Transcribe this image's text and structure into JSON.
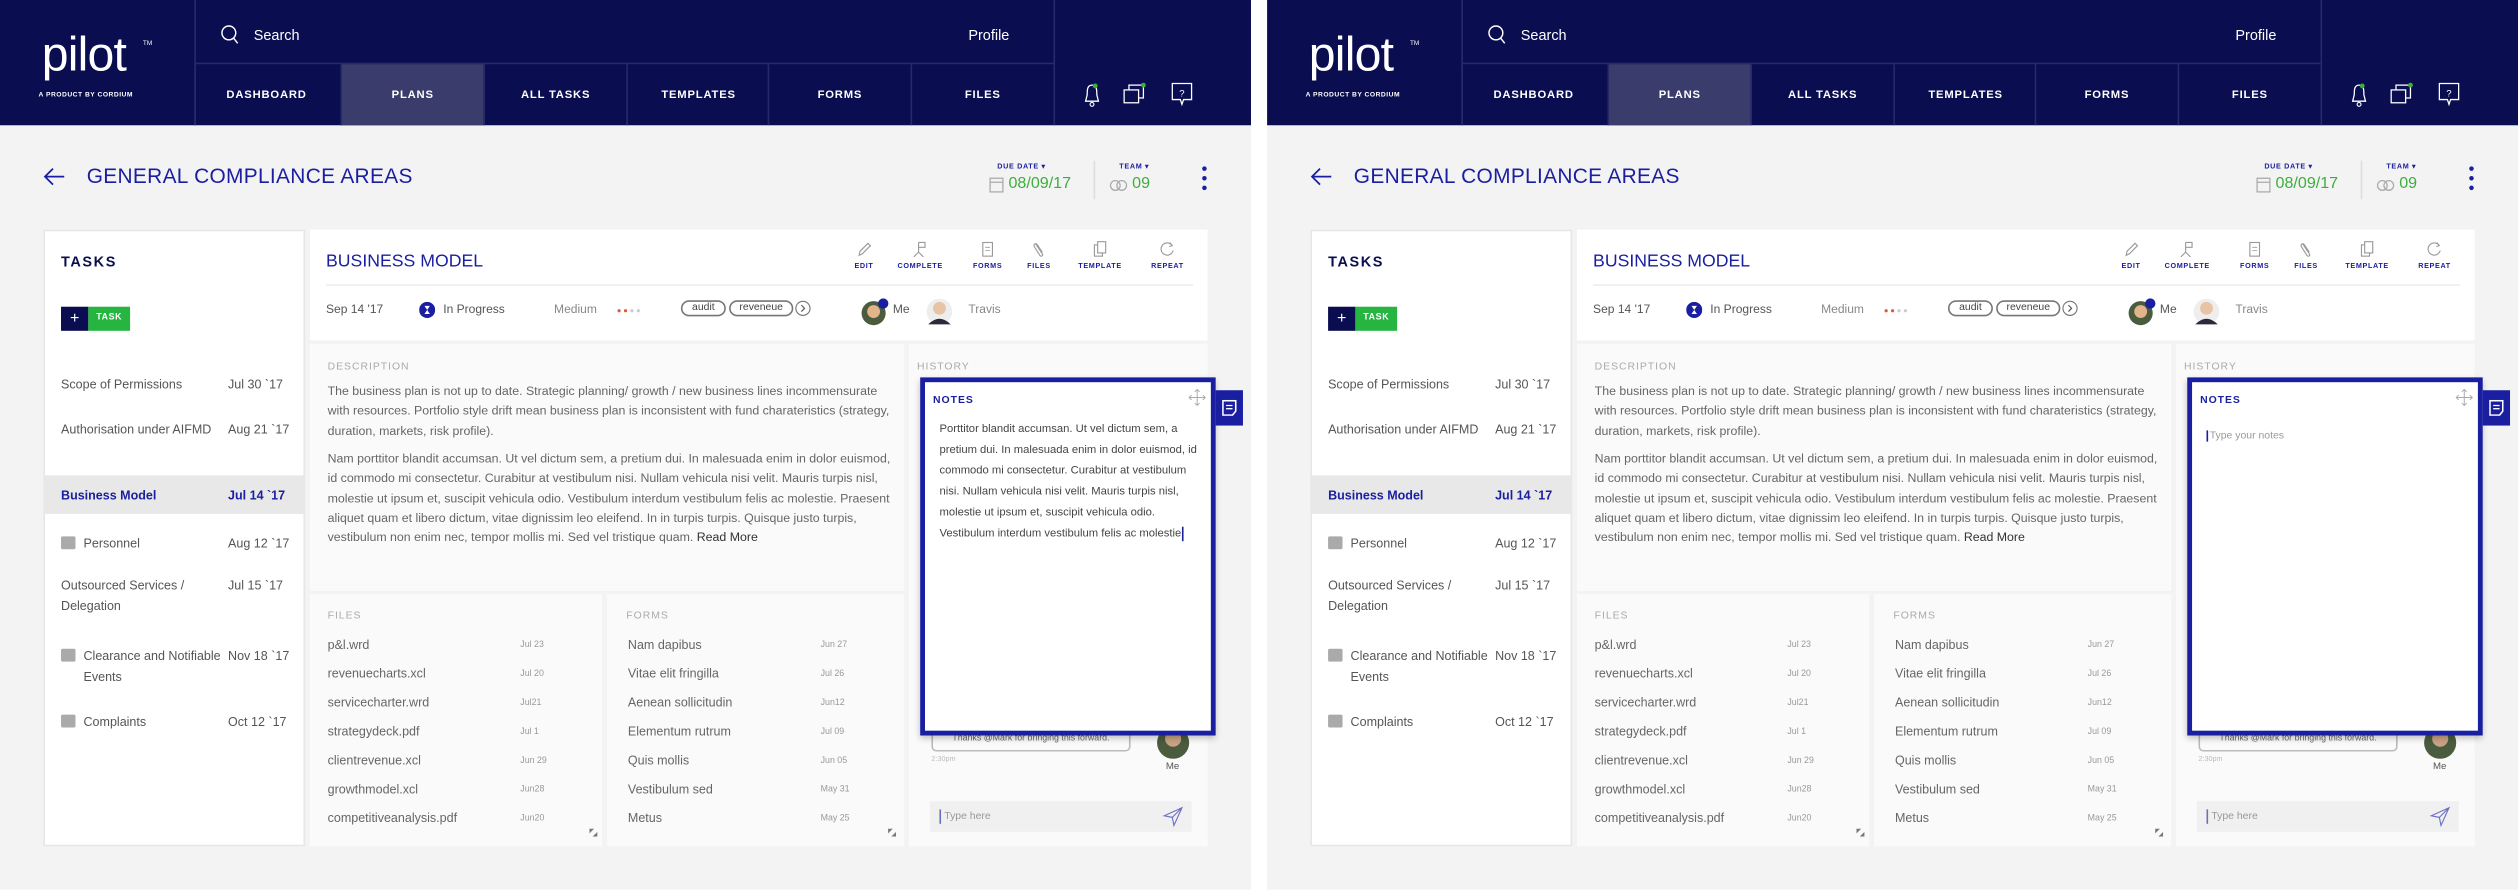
{
  "app": {
    "logo": "pilot",
    "logo_tm": "TM",
    "byline": "A PRODUCT BY CORDIUM",
    "search_placeholder": "Search",
    "profile": "Profile",
    "nav": [
      {
        "label": "DASHBOARD"
      },
      {
        "label": "PLANS",
        "active": true
      },
      {
        "label": "ALL TASKS"
      },
      {
        "label": "TEMPLATES"
      },
      {
        "label": "FORMS"
      },
      {
        "label": "FILES"
      }
    ],
    "header_icons": [
      "bell-icon",
      "chat-icon",
      "help-icon"
    ],
    "page_title": "GENERAL COMPLIANCE AREAS",
    "due_date_label": "DUE DATE ▾",
    "due_date": "08/09/17",
    "team_label": "TEAM ▾",
    "team": "09",
    "colors": {
      "navy": "#0a0d4f",
      "accent": "#1a1ea0",
      "green": "#3cae3c",
      "nav_active": "#3a3d6b"
    }
  },
  "tasks": {
    "heading": "TASKS",
    "add_plus": "+",
    "add_label": "TASK",
    "items": [
      {
        "name": "Scope of Permissions",
        "date": "Jul 30 `17"
      },
      {
        "name": "Authorisation under AIFMD",
        "date": "Aug 21 `17"
      },
      {
        "name": "Business Model",
        "date": "Jul 14 `17",
        "selected": true
      },
      {
        "name": "Personnel",
        "date": "Aug 12 `17",
        "icon": "transfer-icon"
      },
      {
        "name": "Outsourced Services / Delegation",
        "date": "Jul 15 `17"
      },
      {
        "name": "Clearance and Notifiable Events",
        "date": "Nov 18 `17",
        "icon": "alarm-icon"
      },
      {
        "name": "Complaints",
        "date": "Oct 12 `17",
        "icon": "repeat-icon"
      }
    ]
  },
  "task": {
    "title": "BUSINESS MODEL",
    "actions": [
      {
        "label": "EDIT",
        "icon": "pencil-icon"
      },
      {
        "label": "COMPLETE",
        "icon": "flag-icon"
      },
      {
        "label": "FORMS",
        "icon": "clipboard-icon"
      },
      {
        "label": "FILES",
        "icon": "paperclip-icon"
      },
      {
        "label": "TEMPLATE",
        "icon": "copy-icon"
      },
      {
        "label": "REPEAT",
        "icon": "refresh-icon"
      }
    ],
    "date": "Sep 14 '17",
    "status": "In Progress",
    "priority": "Medium",
    "tags": [
      "audit",
      "reveneue"
    ],
    "assignees": [
      "Me",
      "Travis"
    ],
    "description_label": "DESCRIPTION",
    "description_p1": "The business plan is not up to date. Strategic planning/ growth / new business lines incommensurate with resources. Portfolio style drift mean business plan is inconsistent with fund charateristics (strategy, duration, markets, risk profile).",
    "description_p2": "Nam porttitor blandit accumsan. Ut vel dictum sem, a pretium dui. In malesuada enim in dolor euismod, id commodo mi consectetur. Curabitur at vestibulum nisi. Nullam vehicula nisi velit. Mauris turpis nisl, molestie ut ipsum et, suscipit vehicula odio. Vestibulum interdum vestibulum felis ac molestie. Praesent aliquet quam et libero dictum, vitae dignissim leo eleifend. In in turpis turpis. Quisque justo turpis, vestibulum non enim nec, tempor mollis mi. Sed vel tristique quam.",
    "read_more": "Read More",
    "history_label": "HISTORY",
    "files_label": "FILES",
    "files": [
      {
        "name": "p&l.wrd",
        "date": "Jul 23"
      },
      {
        "name": "revenuecharts.xcl",
        "date": "Jul 20"
      },
      {
        "name": "servicecharter.wrd",
        "date": "Jul21"
      },
      {
        "name": "strategydeck.pdf",
        "date": "Jul 1"
      },
      {
        "name": "clientrevenue.xcl",
        "date": "Jun 29"
      },
      {
        "name": "growthmodel.xcl",
        "date": "Jun28"
      },
      {
        "name": "competitiveanalysis.pdf",
        "date": "Jun20"
      }
    ],
    "forms_label": "FORMS",
    "forms": [
      {
        "name": "Nam dapibus",
        "date": "Jun 27"
      },
      {
        "name": "Vitae elit fringilla",
        "date": "Jul 26"
      },
      {
        "name": "Aenean sollicitudin",
        "date": "Jun12"
      },
      {
        "name": "Elementum rutrum",
        "date": "Jul 09"
      },
      {
        "name": "Quis mollis",
        "date": "Jun 05"
      },
      {
        "name": "Vestibulum sed",
        "date": "May 31"
      },
      {
        "name": "Metus",
        "date": "May 25"
      }
    ],
    "chat_message": "Thanks @Mark for bringing this forward.",
    "chat_time": "2:30pm",
    "chat_author": "Me",
    "chat_placeholder": "Type here"
  },
  "panes": [
    {
      "notes": {
        "label": "NOTES",
        "text": "Porttitor blandit accumsan. Ut vel dictum sem, a pretium dui. In malesuada enim in dolor euismod, id commodo mi consectetur. Curabitur at vestibulum nisi. Nullam vehicula nisi velit. Mauris turpis nisl, molestie ut ipsum et, suscipit vehicula odio. Vestibulum interdum vestibulum felis ac molestie",
        "placeholder": ""
      }
    },
    {
      "notes": {
        "label": "NOTES",
        "text": "",
        "placeholder": "Type your notes"
      }
    }
  ]
}
